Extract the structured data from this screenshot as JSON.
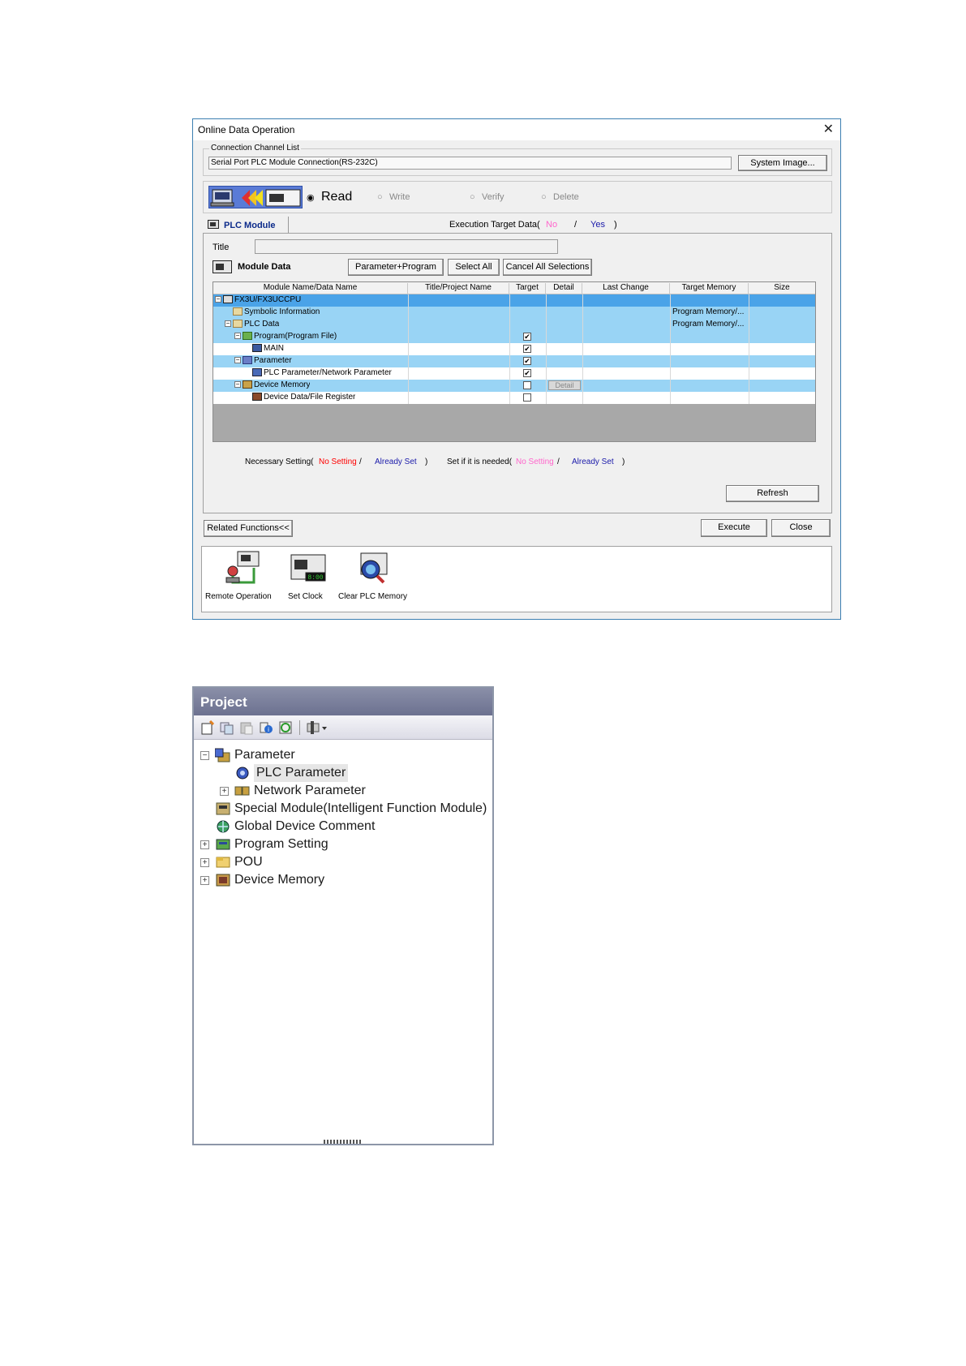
{
  "dialog": {
    "title": "Online Data Operation",
    "connection_group_label": "Connection Channel List",
    "connection_value": "Serial Port  PLC Module Connection(RS-232C)",
    "system_image_button": "System Image...",
    "modes": {
      "read": "Read",
      "write": "Write",
      "verify": "Verify",
      "delete": "Delete",
      "selected": "Read"
    },
    "tab_plc_module": "PLC Module",
    "execution_target_label": "Execution Target Data(",
    "execution_no": "No",
    "execution_sep": "/",
    "execution_yes": "Yes",
    "execution_close": ")",
    "title_label": "Title",
    "title_value": "",
    "module_data_label": "Module Data",
    "btn_param_program": "Parameter+Program",
    "btn_select_all": "Select All",
    "btn_cancel_all": "Cancel All Selections",
    "table": {
      "columns": [
        "Module Name/Data Name",
        "Title/Project Name",
        "Target",
        "Detail",
        "Last Change",
        "Target Memory",
        "Size"
      ],
      "rows": [
        {
          "name": "FX3U/FX3UCCPU",
          "target": null,
          "memory": ""
        },
        {
          "name": "Symbolic Information",
          "target": null,
          "memory": "Program Memory/..."
        },
        {
          "name": "PLC Data",
          "target": null,
          "memory": "Program Memory/..."
        },
        {
          "name": "Program(Program File)",
          "target": true,
          "memory": ""
        },
        {
          "name": "MAIN",
          "target": true,
          "memory": ""
        },
        {
          "name": "Parameter",
          "target": true,
          "memory": ""
        },
        {
          "name": "PLC Parameter/Network Parameter",
          "target": true,
          "memory": ""
        },
        {
          "name": "Device Memory",
          "target": false,
          "detail": "Detail",
          "memory": ""
        },
        {
          "name": "Device Data/File Register",
          "target": false,
          "memory": ""
        }
      ]
    },
    "legend": {
      "necessary_label": "Necessary Setting(",
      "necessary_no": "No Setting",
      "necessary_sep": "/",
      "necessary_yes": "Already Set",
      "necessary_close": ")",
      "ifneeded_label": "Set if it is needed(",
      "ifneeded_no": "No Setting",
      "ifneeded_sep": "/",
      "ifneeded_yes": "Already Set",
      "ifneeded_close": ")"
    },
    "btn_refresh": "Refresh",
    "btn_related": "Related Functions<<",
    "btn_execute": "Execute",
    "btn_close": "Close",
    "related": {
      "remote": "Remote Operation",
      "clock": "Set Clock",
      "clear": "Clear PLC Memory",
      "clock_display": "8:00"
    },
    "colors": {
      "no_setting_necessary": "#ff0000",
      "no_setting_ifneeded": "#ff66cc",
      "already_set": "#1a1aaa",
      "selected_row": "#4aa3e8",
      "blue_row": "#99d4f5"
    }
  },
  "project": {
    "title": "Project",
    "tree": {
      "parameter": "Parameter",
      "plc_parameter": "PLC Parameter",
      "network_parameter": "Network Parameter",
      "special_module": "Special Module(Intelligent Function Module)",
      "global_comment": "Global Device Comment",
      "program_setting": "Program Setting",
      "pou": "POU",
      "device_memory": "Device Memory"
    },
    "expanders": {
      "collapse": "−",
      "expand": "+"
    }
  }
}
